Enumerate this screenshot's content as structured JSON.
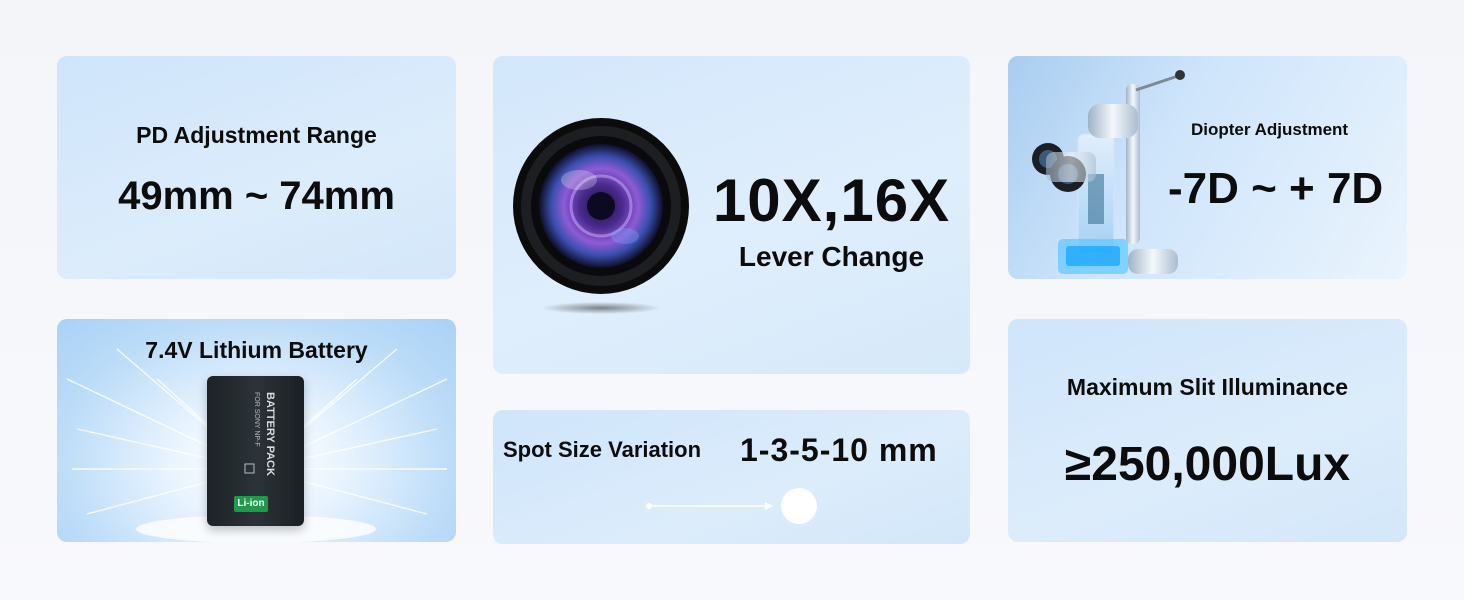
{
  "pd": {
    "label": "PD Adjustment Range",
    "value": "49mm ~ 74mm"
  },
  "battery": {
    "label": "7.4V Lithium Battery",
    "pack_text": "BATTERY PACK",
    "for_text": "FOR SONY NP-F",
    "badge": "Li-ion"
  },
  "lens": {
    "magnification": "10X,16X",
    "subtitle": "Lever Change"
  },
  "spot": {
    "label": "Spot Size Variation",
    "value": "1-3-5-10 mm"
  },
  "diopter": {
    "label": "Diopter Adjustment",
    "value": "-7D ~ + 7D"
  },
  "illuminance": {
    "label": "Maximum Slit Illuminance",
    "value": "≥250,000Lux"
  },
  "colors": {
    "card_bg": "#d5e8fb",
    "text": "#0c0c0c",
    "battery_badge": "#1f9a4a"
  },
  "icons": [
    "camera-lens-icon",
    "battery-icon",
    "slit-lamp-icon",
    "spot-arrow-icon"
  ]
}
